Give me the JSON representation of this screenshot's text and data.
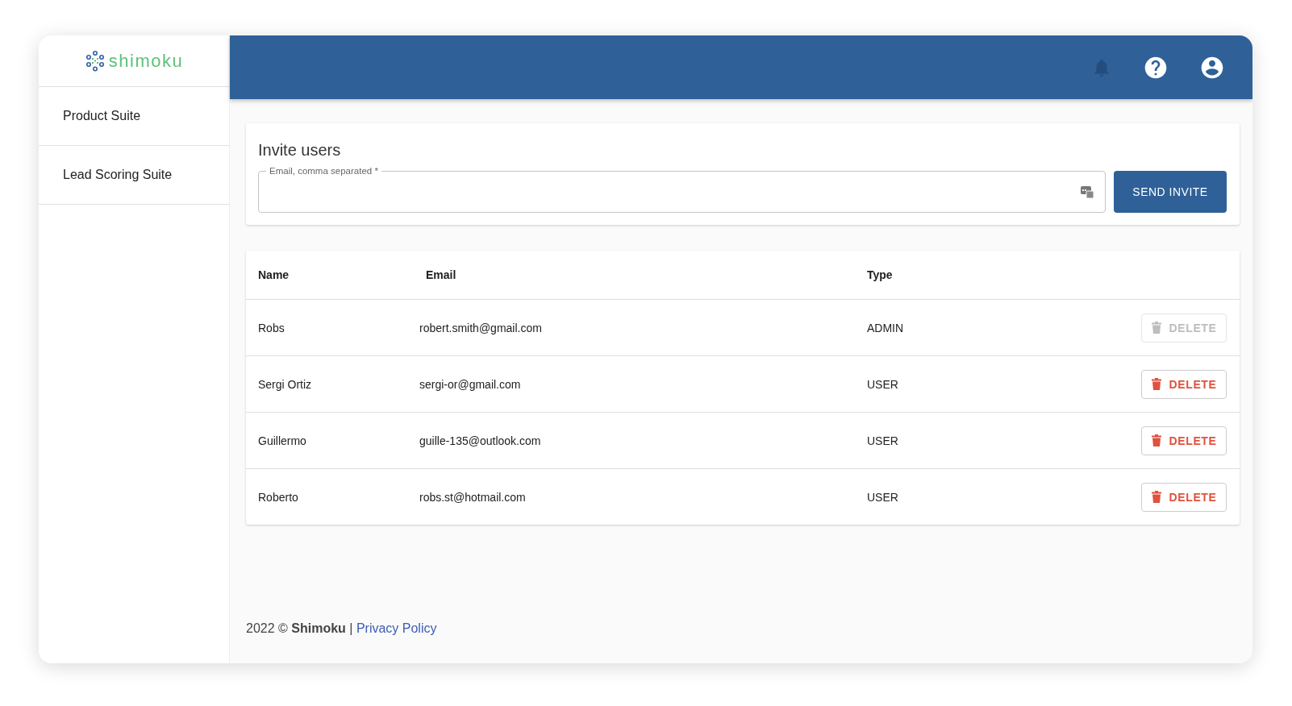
{
  "logo": {
    "text": "shimoku"
  },
  "sidebar": {
    "items": [
      {
        "label": "Product Suite"
      },
      {
        "label": "Lead Scoring Suite"
      }
    ]
  },
  "invite": {
    "title": "Invite users",
    "field_label": "Email, comma separated *",
    "button": "SEND INVITE"
  },
  "table": {
    "columns": [
      "Name",
      "Email",
      "Type"
    ],
    "rows": [
      {
        "name": "Robs",
        "email": "robert.smith@gmail.com",
        "type": "ADMIN",
        "action": "DELETE",
        "disabled": true
      },
      {
        "name": "Sergi Ortiz",
        "email": "sergi-or@gmail.com",
        "type": "USER",
        "action": "DELETE",
        "disabled": false
      },
      {
        "name": "Guillermo",
        "email": "guille-135@outlook.com",
        "type": "USER",
        "action": "DELETE",
        "disabled": false
      },
      {
        "name": "Roberto",
        "email": "robs.st@hotmail.com",
        "type": "USER",
        "action": "DELETE",
        "disabled": false
      }
    ]
  },
  "footer": {
    "text": "2022 © **Shimoku** | ",
    "link": "Privacy Policy"
  }
}
